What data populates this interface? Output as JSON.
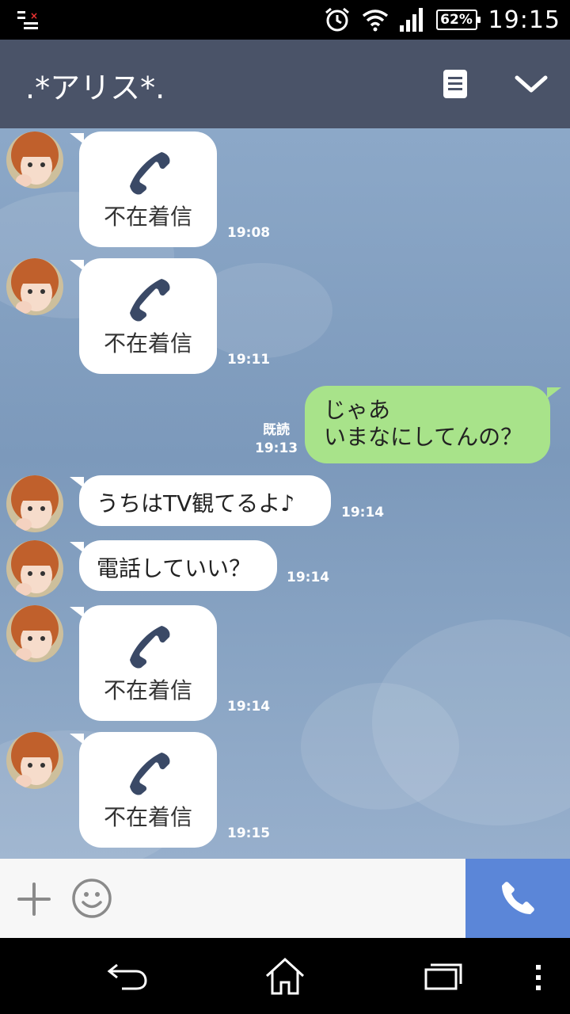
{
  "status_bar": {
    "time": "19:15",
    "battery": "62%",
    "icons": [
      "notification-icon",
      "alarm-icon",
      "wifi-icon",
      "signal-icon",
      "battery-icon"
    ]
  },
  "header": {
    "title": ".*アリス*.",
    "icons": [
      "notes-icon",
      "chevron-down-icon"
    ]
  },
  "messages": [
    {
      "side": "left",
      "type": "missed-call",
      "text": "不在着信",
      "time": "19:08"
    },
    {
      "side": "left",
      "type": "missed-call",
      "text": "不在着信",
      "time": "19:11"
    },
    {
      "side": "right",
      "type": "text",
      "lines": [
        "じゃあ",
        "いまなにしてんの？"
      ],
      "read": "既読",
      "time": "19:13"
    },
    {
      "side": "left",
      "type": "text",
      "text": "うちはTV観てるよ♪",
      "time": "19:14"
    },
    {
      "side": "left",
      "type": "text",
      "text": "電話していい？",
      "time": "19:14"
    },
    {
      "side": "left",
      "type": "missed-call",
      "text": "不在着信",
      "time": "19:14"
    },
    {
      "side": "left",
      "type": "missed-call",
      "text": "不在着信",
      "time": "19:15"
    }
  ],
  "input_bar": {
    "icons": [
      "plus-icon",
      "smiley-icon",
      "phone-icon"
    ]
  },
  "nav_bar": {
    "icons": [
      "back-icon",
      "home-icon",
      "recents-icon",
      "more-icon"
    ]
  },
  "colors": {
    "header": "#4a5368",
    "own_bubble": "#a8e38a",
    "call_button": "#5b86d8",
    "chat_bg": "#8ca8c8"
  }
}
